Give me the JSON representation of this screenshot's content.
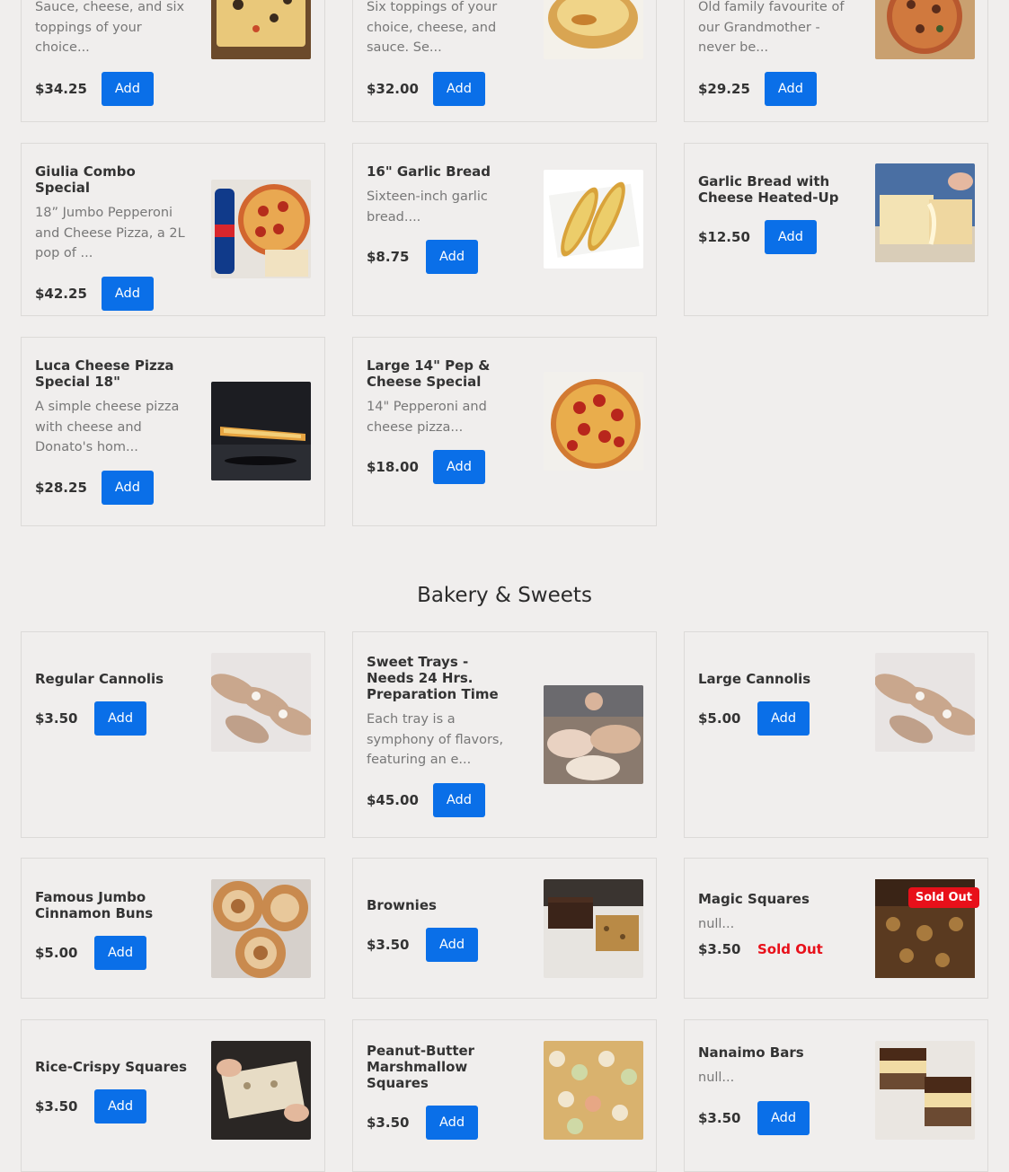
{
  "add_label": "Add",
  "sold_out_label": "Sold Out",
  "pizza": [
    {
      "name": "",
      "desc": "Sauce, cheese, and six toppings of your choice...",
      "price": "$34.25",
      "image": "pizza-slab-image"
    },
    {
      "name": "",
      "desc": "Six toppings of your choice, cheese, and sauce. Se...",
      "price": "$32.00",
      "image": "calzone-image"
    },
    {
      "name": "",
      "desc": "Old family favourite of our Grandmother - never be...",
      "price": "$29.25",
      "image": "pizza-box-image"
    },
    {
      "name": "Giulia Combo Special",
      "desc": "18” Jumbo Pepperoni and Cheese Pizza, a 2L pop of ...",
      "price": "$42.25",
      "image": "pepsi-combo-image"
    },
    {
      "name": "16\" Garlic Bread",
      "desc": "Sixteen-inch garlic bread....",
      "price": "$8.75",
      "image": "garlic-bread-image"
    },
    {
      "name": "Garlic Bread with Cheese Heated-Up",
      "desc": "",
      "price": "$12.50",
      "image": "cheese-bread-image"
    },
    {
      "name": "Luca Cheese Pizza Special 18\"",
      "desc": "A simple cheese pizza with cheese and Donato's hom...",
      "price": "$28.25",
      "image": "cheese-pizza-oven-image"
    },
    {
      "name": "Large 14\" Pep & Cheese Special",
      "desc": "14\" Pepperoni and cheese pizza...",
      "price": "$18.00",
      "image": "pepperoni-pizza-image"
    }
  ],
  "bakery": {
    "title": "Bakery & Sweets",
    "items": [
      {
        "name": "Regular Cannolis",
        "desc": "",
        "price": "$3.50",
        "image": "cannoli-image"
      },
      {
        "name": "Sweet Trays - Needs 24 Hrs. Preparation Time",
        "desc": "Each tray is a symphony of flavors, featuring an e...",
        "price": "$45.00",
        "image": "sweet-trays-image"
      },
      {
        "name": "Large Cannolis",
        "desc": "",
        "price": "$5.00",
        "image": "cannoli-image"
      },
      {
        "name": "Famous Jumbo Cinnamon Buns",
        "desc": "",
        "price": "$5.00",
        "image": "cinnamon-bun-image"
      },
      {
        "name": "Brownies",
        "desc": "",
        "price": "$3.50",
        "image": "brownie-image"
      },
      {
        "name": "Magic Squares",
        "desc": "null...",
        "price": "$3.50",
        "image": "magic-squares-image",
        "sold_out": true
      },
      {
        "name": "Rice-Crispy Squares",
        "desc": "",
        "price": "$3.50",
        "image": "rice-crispy-image"
      },
      {
        "name": "Peanut-Butter Marshmallow Squares",
        "desc": "",
        "price": "$3.50",
        "image": "marshmallow-squares-image"
      },
      {
        "name": "Nanaimo Bars",
        "desc": "null...",
        "price": "$3.50",
        "image": "nanaimo-bar-image"
      }
    ]
  },
  "colors": {
    "accent": "#0a6fe8",
    "sold_out": "#e8101a",
    "background": "#f0eeed"
  }
}
